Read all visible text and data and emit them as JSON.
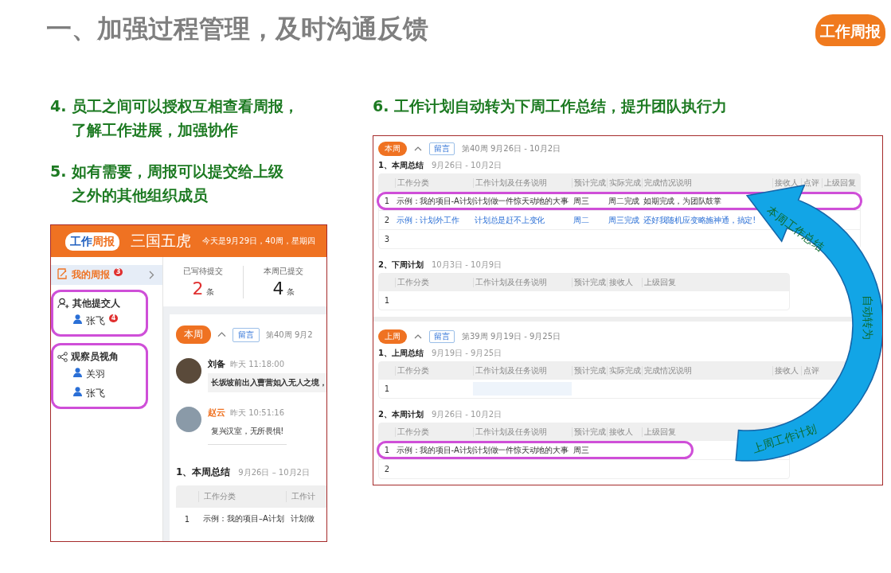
{
  "slide": {
    "title": "一、加强过程管理，及时沟通反馈",
    "logo": "工作周报"
  },
  "left": {
    "points": [
      {
        "lines": [
          "4. 员工之间可以授权互相查看周报，",
          "了解工作进展，加强协作"
        ]
      },
      {
        "lines": [
          "5. 如有需要，周报可以提交给上级",
          "之外的其他组织成员"
        ]
      }
    ],
    "app": {
      "brand": [
        "工作",
        "周报"
      ],
      "team": "三国五虎",
      "today": "今天是9月29日，40周，星期四",
      "sidebar": [
        {
          "kind": "link",
          "label": "我的周报",
          "badge": "3",
          "selected": true
        },
        {
          "kind": "group",
          "label": "其他提交人",
          "highlighted": true,
          "members": [
            {
              "name": "张飞",
              "badge": "4"
            }
          ]
        },
        {
          "kind": "group",
          "label": "观察员视角",
          "highlighted": true,
          "members": [
            {
              "name": "关羽"
            },
            {
              "name": "张飞"
            }
          ]
        }
      ],
      "stats": [
        {
          "label": "已写待提交",
          "value": "2",
          "unit": "条",
          "kind": "pending"
        },
        {
          "label": "本周已提交",
          "value": "4",
          "unit": "条",
          "kind": "done"
        }
      ],
      "week": {
        "tag": "本周",
        "button": "留言",
        "period": "第40周 9月2"
      },
      "comments": [
        {
          "author": "刘备",
          "color": "#222222",
          "time": "昨天 11:18:00",
          "text": "长坂坡前出入曹营如入无人之境，",
          "kind": "boxed"
        },
        {
          "author": "赵云",
          "color": "#ef7222",
          "time": "昨天 10:51:16",
          "text": "复兴汉室，无所畏惧!",
          "kind": "underlined"
        }
      ],
      "section": {
        "title": "1、本周总结",
        "dates": "9月26日 – 10月2日",
        "columns": [
          "工作分类",
          "工作计"
        ],
        "rows": [
          {
            "number": "1",
            "cells": [
              "示例：我的项目–A计划",
              "计划做"
            ]
          }
        ]
      }
    }
  },
  "right": {
    "point": {
      "lines": [
        "6. 工作计划自动转为下周工作总结，提升团队执行力"
      ]
    },
    "report": {
      "weeks": [
        {
          "tag": "本周",
          "button": "留言",
          "period": "第40周 9月26日 - 10月2日",
          "sections": [
            {
              "kind": "summary",
              "title": "1、本周总结",
              "dates": "9月26日 - 10月2日",
              "columns": [
                "工作分类",
                "工作计划及任务说明",
                "预计完成",
                "实际完成",
                "完成情况说明",
                "接收人",
                "点评",
                "上级回复"
              ],
              "rows": [
                {
                  "number": "1",
                  "cells": [
                    "示例：我的项目-A计划",
                    "计划做一件惊天动地的大事",
                    "周三",
                    "周二完成",
                    "如期完成，为团队鼓掌"
                  ],
                  "kind": "planned",
                  "highlighted": true,
                  "focused": false
                },
                {
                  "number": "2",
                  "cells": [
                    "示例：计划外工作",
                    "计划总是赶不上变化",
                    "周二",
                    "周三完成",
                    "还好我随机应变略施神通，搞定!"
                  ],
                  "kind": "unplanned",
                  "highlighted": false,
                  "focused": false
                },
                {
                  "number": "3",
                  "cells": [],
                  "kind": "planned",
                  "highlighted": false,
                  "focused": false
                }
              ]
            },
            {
              "kind": "plan",
              "title": "2、下周计划",
              "dates": "10月3日 - 10月9日",
              "columns": [
                "工作分类",
                "工作计划及任务说明",
                "预计完成",
                "接收人",
                "上级回复"
              ],
              "rows": [
                {
                  "number": "1",
                  "cells": [],
                  "kind": "planned",
                  "highlighted": false,
                  "focused": false
                }
              ]
            }
          ]
        },
        {
          "tag": "上周",
          "button": "留言",
          "period": "第39周 9月19日 - 9月25日",
          "sections": [
            {
              "kind": "summary",
              "title": "1、上周总结",
              "dates": "9月19日 - 9月25日",
              "columns": [
                "工作分类",
                "工作计划及任务说明",
                "预计完成",
                "实际完成",
                "完成情况说明",
                "接收人",
                "点评"
              ],
              "rows": [
                {
                  "number": "1",
                  "cells": [],
                  "kind": "planned",
                  "highlighted": false,
                  "focused": true
                }
              ]
            },
            {
              "kind": "plan",
              "title": "2、本周计划",
              "dates": "9月26日 - 10月2日",
              "columns": [
                "工作分类",
                "工作计划及任务说明",
                "预计完成",
                "接收人",
                "上级回复"
              ],
              "rows": [
                {
                  "number": "1",
                  "cells": [
                    "示例：我的项目-A计划",
                    "计划做一件惊天动地的大事",
                    "周三"
                  ],
                  "kind": "planned",
                  "highlighted": true,
                  "focused": false
                },
                {
                  "number": "2",
                  "cells": [],
                  "kind": "planned",
                  "highlighted": false,
                  "focused": false
                }
              ]
            }
          ]
        }
      ],
      "arrow": {
        "labels": [
          "本周工作总结",
          "自动转为",
          "上周工作计划"
        ]
      }
    }
  }
}
